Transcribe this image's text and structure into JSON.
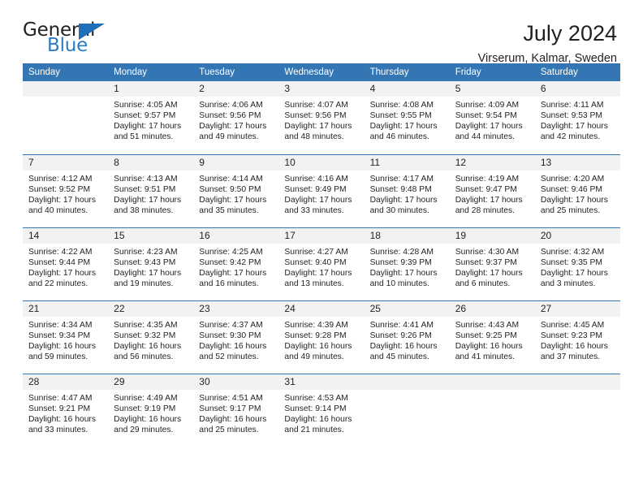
{
  "brand": {
    "name_top": "General",
    "name_bottom": "Blue",
    "accent_color": "#2b7cc2",
    "triangle_color": "#1e6fb8"
  },
  "header": {
    "title": "July 2024",
    "subtitle": "Virserum, Kalmar, Sweden"
  },
  "calendar": {
    "header_bg": "#3476b4",
    "header_text_color": "#ffffff",
    "daynum_bg": "#f2f2f2",
    "weekdays": [
      "Sunday",
      "Monday",
      "Tuesday",
      "Wednesday",
      "Thursday",
      "Friday",
      "Saturday"
    ],
    "weeks": [
      [
        {
          "day": ""
        },
        {
          "day": "1",
          "sunrise": "Sunrise: 4:05 AM",
          "sunset": "Sunset: 9:57 PM",
          "daylight_line1": "Daylight: 17 hours",
          "daylight_line2": "and 51 minutes."
        },
        {
          "day": "2",
          "sunrise": "Sunrise: 4:06 AM",
          "sunset": "Sunset: 9:56 PM",
          "daylight_line1": "Daylight: 17 hours",
          "daylight_line2": "and 49 minutes."
        },
        {
          "day": "3",
          "sunrise": "Sunrise: 4:07 AM",
          "sunset": "Sunset: 9:56 PM",
          "daylight_line1": "Daylight: 17 hours",
          "daylight_line2": "and 48 minutes."
        },
        {
          "day": "4",
          "sunrise": "Sunrise: 4:08 AM",
          "sunset": "Sunset: 9:55 PM",
          "daylight_line1": "Daylight: 17 hours",
          "daylight_line2": "and 46 minutes."
        },
        {
          "day": "5",
          "sunrise": "Sunrise: 4:09 AM",
          "sunset": "Sunset: 9:54 PM",
          "daylight_line1": "Daylight: 17 hours",
          "daylight_line2": "and 44 minutes."
        },
        {
          "day": "6",
          "sunrise": "Sunrise: 4:11 AM",
          "sunset": "Sunset: 9:53 PM",
          "daylight_line1": "Daylight: 17 hours",
          "daylight_line2": "and 42 minutes."
        }
      ],
      [
        {
          "day": "7",
          "sunrise": "Sunrise: 4:12 AM",
          "sunset": "Sunset: 9:52 PM",
          "daylight_line1": "Daylight: 17 hours",
          "daylight_line2": "and 40 minutes."
        },
        {
          "day": "8",
          "sunrise": "Sunrise: 4:13 AM",
          "sunset": "Sunset: 9:51 PM",
          "daylight_line1": "Daylight: 17 hours",
          "daylight_line2": "and 38 minutes."
        },
        {
          "day": "9",
          "sunrise": "Sunrise: 4:14 AM",
          "sunset": "Sunset: 9:50 PM",
          "daylight_line1": "Daylight: 17 hours",
          "daylight_line2": "and 35 minutes."
        },
        {
          "day": "10",
          "sunrise": "Sunrise: 4:16 AM",
          "sunset": "Sunset: 9:49 PM",
          "daylight_line1": "Daylight: 17 hours",
          "daylight_line2": "and 33 minutes."
        },
        {
          "day": "11",
          "sunrise": "Sunrise: 4:17 AM",
          "sunset": "Sunset: 9:48 PM",
          "daylight_line1": "Daylight: 17 hours",
          "daylight_line2": "and 30 minutes."
        },
        {
          "day": "12",
          "sunrise": "Sunrise: 4:19 AM",
          "sunset": "Sunset: 9:47 PM",
          "daylight_line1": "Daylight: 17 hours",
          "daylight_line2": "and 28 minutes."
        },
        {
          "day": "13",
          "sunrise": "Sunrise: 4:20 AM",
          "sunset": "Sunset: 9:46 PM",
          "daylight_line1": "Daylight: 17 hours",
          "daylight_line2": "and 25 minutes."
        }
      ],
      [
        {
          "day": "14",
          "sunrise": "Sunrise: 4:22 AM",
          "sunset": "Sunset: 9:44 PM",
          "daylight_line1": "Daylight: 17 hours",
          "daylight_line2": "and 22 minutes."
        },
        {
          "day": "15",
          "sunrise": "Sunrise: 4:23 AM",
          "sunset": "Sunset: 9:43 PM",
          "daylight_line1": "Daylight: 17 hours",
          "daylight_line2": "and 19 minutes."
        },
        {
          "day": "16",
          "sunrise": "Sunrise: 4:25 AM",
          "sunset": "Sunset: 9:42 PM",
          "daylight_line1": "Daylight: 17 hours",
          "daylight_line2": "and 16 minutes."
        },
        {
          "day": "17",
          "sunrise": "Sunrise: 4:27 AM",
          "sunset": "Sunset: 9:40 PM",
          "daylight_line1": "Daylight: 17 hours",
          "daylight_line2": "and 13 minutes."
        },
        {
          "day": "18",
          "sunrise": "Sunrise: 4:28 AM",
          "sunset": "Sunset: 9:39 PM",
          "daylight_line1": "Daylight: 17 hours",
          "daylight_line2": "and 10 minutes."
        },
        {
          "day": "19",
          "sunrise": "Sunrise: 4:30 AM",
          "sunset": "Sunset: 9:37 PM",
          "daylight_line1": "Daylight: 17 hours",
          "daylight_line2": "and 6 minutes."
        },
        {
          "day": "20",
          "sunrise": "Sunrise: 4:32 AM",
          "sunset": "Sunset: 9:35 PM",
          "daylight_line1": "Daylight: 17 hours",
          "daylight_line2": "and 3 minutes."
        }
      ],
      [
        {
          "day": "21",
          "sunrise": "Sunrise: 4:34 AM",
          "sunset": "Sunset: 9:34 PM",
          "daylight_line1": "Daylight: 16 hours",
          "daylight_line2": "and 59 minutes."
        },
        {
          "day": "22",
          "sunrise": "Sunrise: 4:35 AM",
          "sunset": "Sunset: 9:32 PM",
          "daylight_line1": "Daylight: 16 hours",
          "daylight_line2": "and 56 minutes."
        },
        {
          "day": "23",
          "sunrise": "Sunrise: 4:37 AM",
          "sunset": "Sunset: 9:30 PM",
          "daylight_line1": "Daylight: 16 hours",
          "daylight_line2": "and 52 minutes."
        },
        {
          "day": "24",
          "sunrise": "Sunrise: 4:39 AM",
          "sunset": "Sunset: 9:28 PM",
          "daylight_line1": "Daylight: 16 hours",
          "daylight_line2": "and 49 minutes."
        },
        {
          "day": "25",
          "sunrise": "Sunrise: 4:41 AM",
          "sunset": "Sunset: 9:26 PM",
          "daylight_line1": "Daylight: 16 hours",
          "daylight_line2": "and 45 minutes."
        },
        {
          "day": "26",
          "sunrise": "Sunrise: 4:43 AM",
          "sunset": "Sunset: 9:25 PM",
          "daylight_line1": "Daylight: 16 hours",
          "daylight_line2": "and 41 minutes."
        },
        {
          "day": "27",
          "sunrise": "Sunrise: 4:45 AM",
          "sunset": "Sunset: 9:23 PM",
          "daylight_line1": "Daylight: 16 hours",
          "daylight_line2": "and 37 minutes."
        }
      ],
      [
        {
          "day": "28",
          "sunrise": "Sunrise: 4:47 AM",
          "sunset": "Sunset: 9:21 PM",
          "daylight_line1": "Daylight: 16 hours",
          "daylight_line2": "and 33 minutes."
        },
        {
          "day": "29",
          "sunrise": "Sunrise: 4:49 AM",
          "sunset": "Sunset: 9:19 PM",
          "daylight_line1": "Daylight: 16 hours",
          "daylight_line2": "and 29 minutes."
        },
        {
          "day": "30",
          "sunrise": "Sunrise: 4:51 AM",
          "sunset": "Sunset: 9:17 PM",
          "daylight_line1": "Daylight: 16 hours",
          "daylight_line2": "and 25 minutes."
        },
        {
          "day": "31",
          "sunrise": "Sunrise: 4:53 AM",
          "sunset": "Sunset: 9:14 PM",
          "daylight_line1": "Daylight: 16 hours",
          "daylight_line2": "and 21 minutes."
        },
        {
          "day": ""
        },
        {
          "day": ""
        },
        {
          "day": ""
        }
      ]
    ]
  }
}
